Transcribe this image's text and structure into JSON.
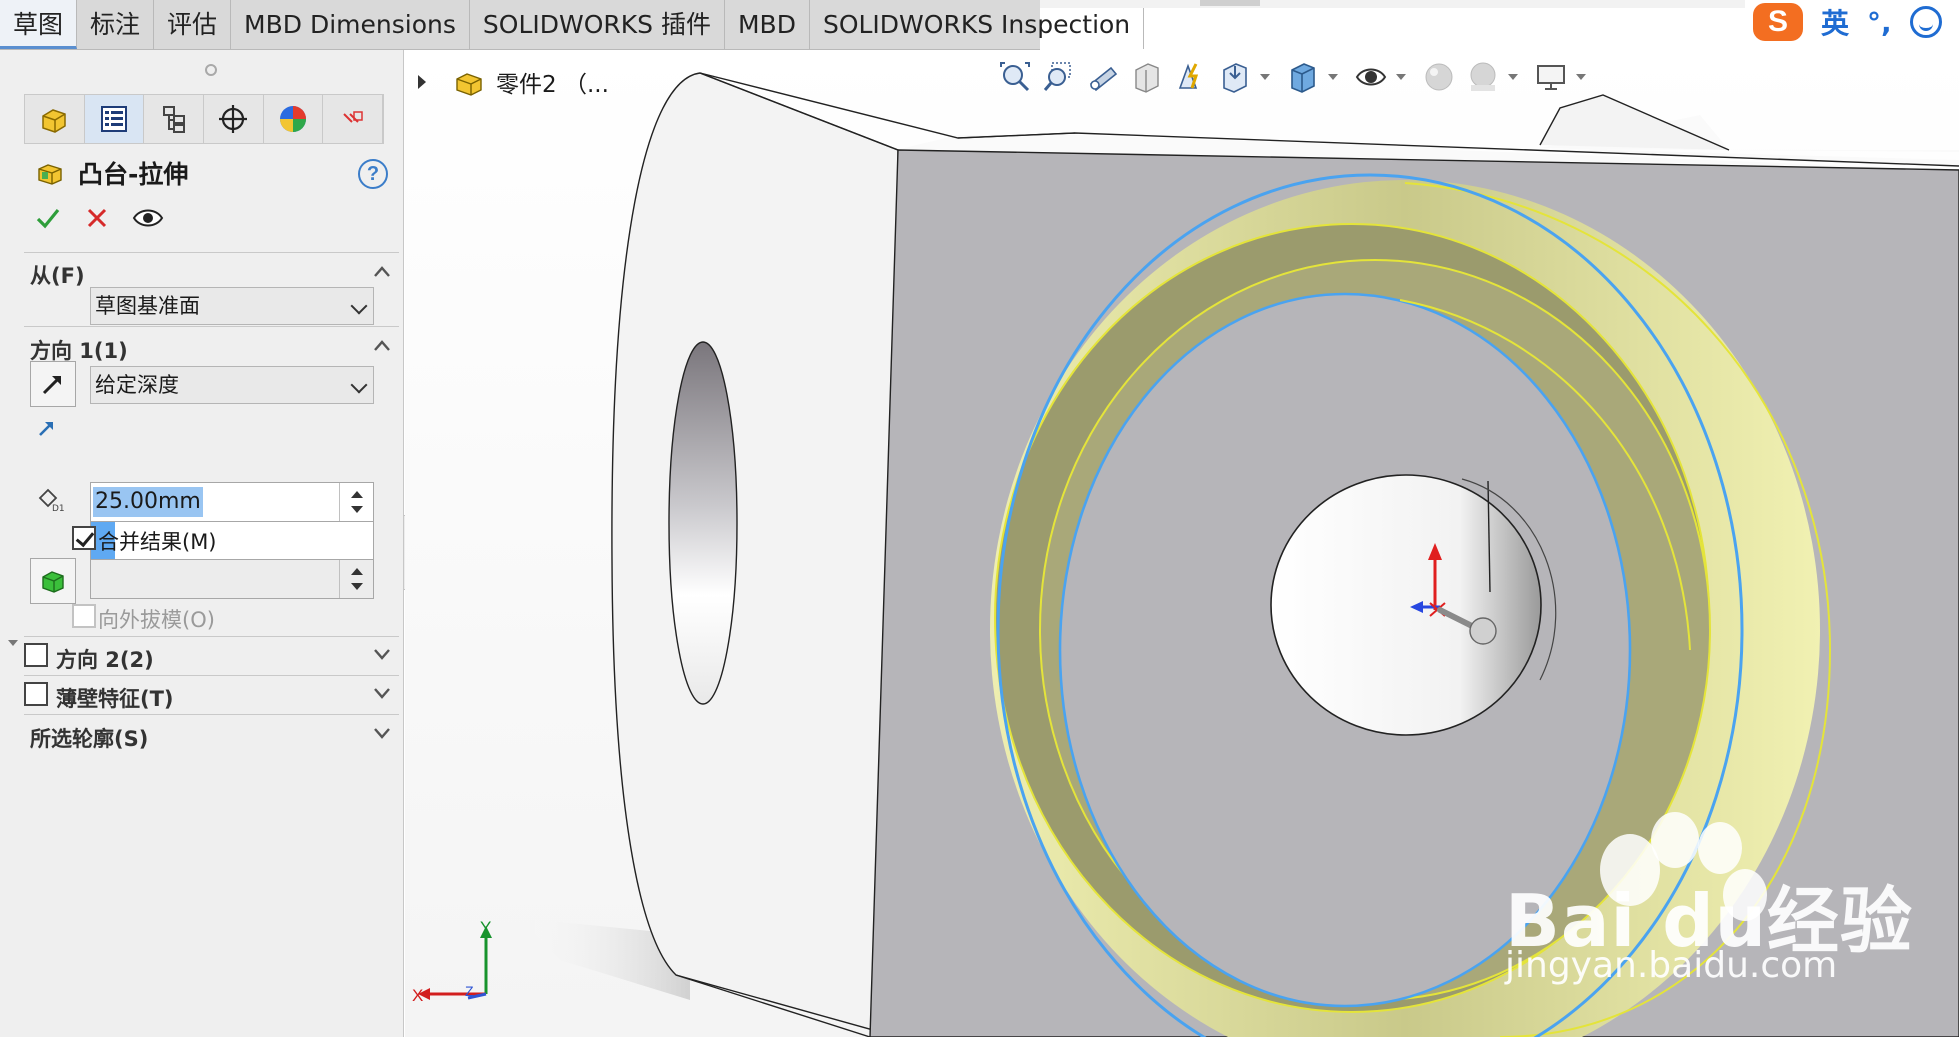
{
  "tabs": [
    {
      "label": "草图",
      "active": true
    },
    {
      "label": "标注",
      "active": false
    },
    {
      "label": "评估",
      "active": false
    },
    {
      "label": "MBD Dimensions",
      "active": false
    },
    {
      "label": "SOLIDWORKS 插件",
      "active": false
    },
    {
      "label": "MBD",
      "active": false
    },
    {
      "label": "SOLIDWORKS Inspection",
      "active": false
    }
  ],
  "ime": {
    "logo": "S",
    "lang": "英",
    "punct": "°,"
  },
  "panel": {
    "feature_title": "凸台-拉伸",
    "help_label": "?",
    "from_section": {
      "title": "从(F)",
      "start_condition": "草图基准面"
    },
    "direction1": {
      "title": "方向 1(1)",
      "end_condition": "给定深度",
      "depth": "25.00mm",
      "merge_result": {
        "label": "合并结果(M)",
        "checked": true
      },
      "draft_outward": {
        "label": "向外拔模(O)",
        "checked": false,
        "enabled": false
      }
    },
    "direction2": {
      "title": "方向 2(2)",
      "checked": false
    },
    "thin_feature": {
      "title": "薄壁特征(T)",
      "checked": false
    },
    "selected_contours": {
      "title": "所选轮廓(S)"
    }
  },
  "tree": {
    "label": "零件2 （..."
  },
  "triad": {
    "x": "X",
    "y": "Y",
    "z": "Z"
  },
  "watermark": {
    "brand": "Bai du经验",
    "url": "jingyan.baidu.com"
  },
  "colors": {
    "accent": "#5a8fd0",
    "model_face": "#b5b4b8",
    "preview_fill": "#9a9a6b",
    "preview_edge": "#e6e633",
    "highlight_edge": "#4aa3f0"
  }
}
